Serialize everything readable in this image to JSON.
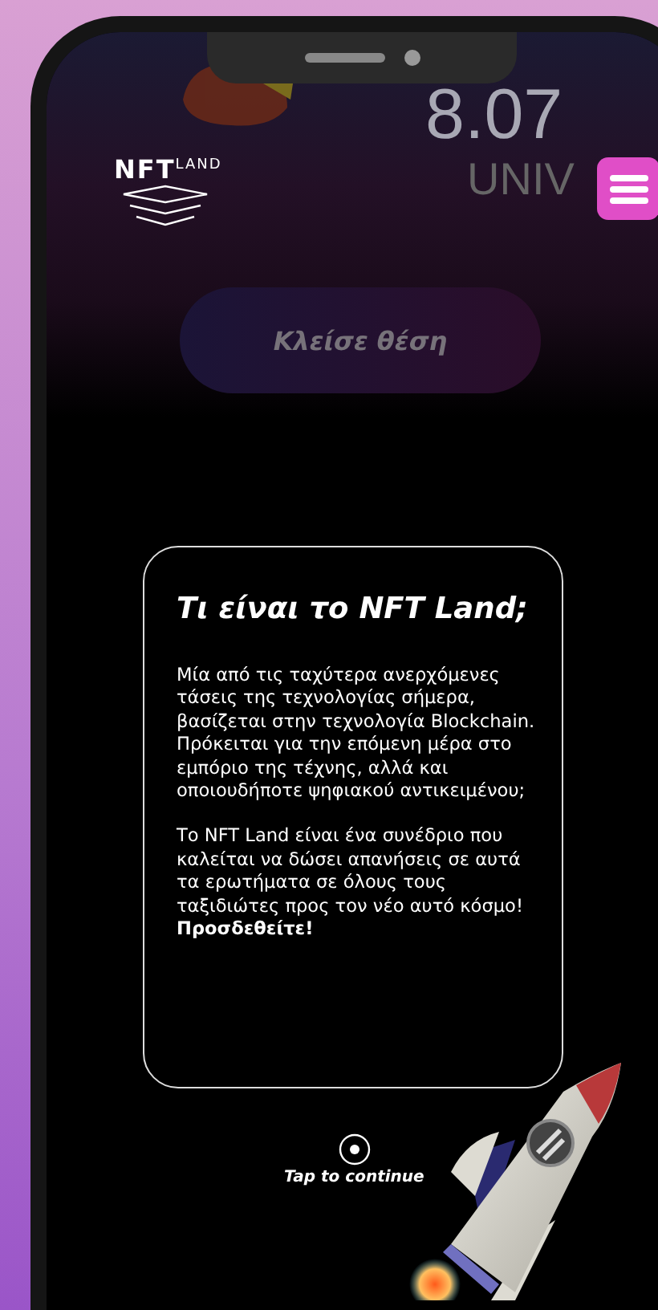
{
  "header": {
    "logo_main": "NFT",
    "logo_sub": "LAND",
    "background_date": "8.07",
    "background_word": "UNIV"
  },
  "booking_button": {
    "label": "Κλείσε θέση"
  },
  "modal": {
    "title": "Τι είναι το NFT Land;",
    "paragraphs": [
      "Μία από τις ταχύτερα ανερχόμενες τάσεις της τεχνολογίας σήμερα, βασίζεται στην τεχνολογία Blockchain. Πρόκειται για την επόμενη μέρα στο εμπόριο της τέχνης, αλλά και οποιουδήποτε ψηφιακού αντικειμένου;",
      "Το NFT Land είναι ένα συνέδριο που καλείται να δώσει απανήσεις σε αυτά τα ερωτήματα σε όλους τους ταξιδιώτες προς τον νέο αυτό κόσμο! **Προσδεθείτε!**"
    ]
  },
  "continue_hint": {
    "label": "Tap to continue"
  }
}
